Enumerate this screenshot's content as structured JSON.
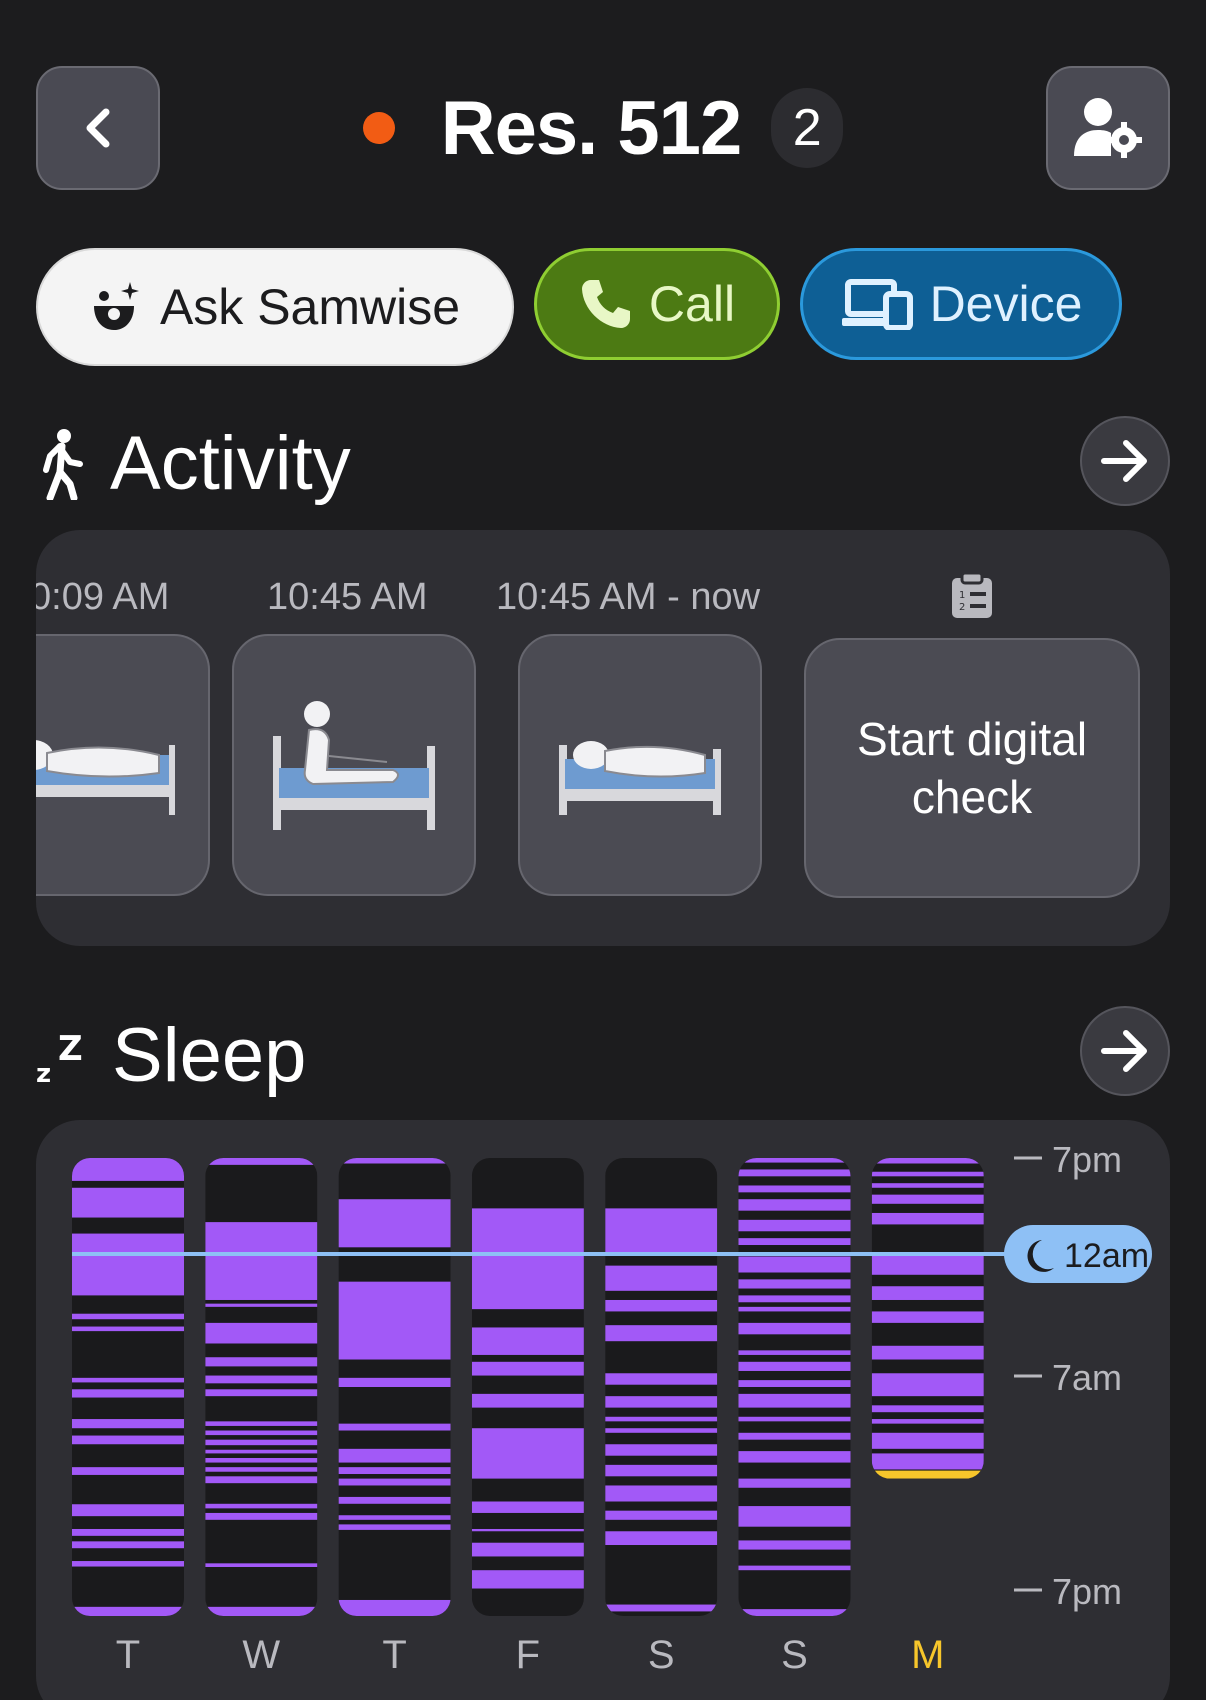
{
  "header": {
    "back_icon": "chevron-left-icon",
    "status_color": "#f25c14",
    "title": "Res. 512",
    "count": "2",
    "profile_icon": "user-settings-icon"
  },
  "actions": {
    "samwise_label": "Ask Samwise",
    "call_label": "Call",
    "device_label": "Device"
  },
  "activity": {
    "title": "Activity",
    "items": [
      {
        "time": "0:09 AM",
        "icon": "bed-lying-icon"
      },
      {
        "time": "10:45 AM",
        "icon": "bed-sitting-icon"
      },
      {
        "time": "10:45 AM - now",
        "icon": "bed-lying-icon"
      }
    ],
    "check_icon": "clipboard-list-icon",
    "check_label": "Start digital check"
  },
  "sleep": {
    "title": "Sleep",
    "now_label": "12am"
  },
  "chart_data": {
    "type": "heatmap",
    "categories": [
      "T",
      "W",
      "T",
      "F",
      "S",
      "S",
      "M"
    ],
    "highlighted_category": "M",
    "y_ticks": [
      "7pm",
      "7am",
      "7pm"
    ],
    "current_marker": "12am",
    "colors": {
      "asleep": "#a259f7",
      "awake": "#1a1a1c",
      "highlight": "#f7c62b",
      "marker": "#8ec0f5"
    },
    "series": [
      {
        "day": "T",
        "asleep": [
          [
            0,
            0.05
          ],
          [
            0.065,
            0.13
          ],
          [
            0.165,
            0.3
          ],
          [
            0.34,
            0.352
          ],
          [
            0.368,
            0.378
          ],
          [
            0.48,
            0.49
          ],
          [
            0.505,
            0.523
          ],
          [
            0.57,
            0.59
          ],
          [
            0.606,
            0.625
          ],
          [
            0.675,
            0.692
          ],
          [
            0.756,
            0.782
          ],
          [
            0.81,
            0.825
          ],
          [
            0.837,
            0.852
          ],
          [
            0.88,
            0.892
          ],
          [
            0.98,
            1.0
          ]
        ]
      },
      {
        "day": "W",
        "asleep": [
          [
            0,
            0.015
          ],
          [
            0.14,
            0.31
          ],
          [
            0.318,
            0.325
          ],
          [
            0.36,
            0.405
          ],
          [
            0.435,
            0.455
          ],
          [
            0.475,
            0.492
          ],
          [
            0.505,
            0.52
          ],
          [
            0.575,
            0.585
          ],
          [
            0.595,
            0.605
          ],
          [
            0.615,
            0.627
          ],
          [
            0.637,
            0.645
          ],
          [
            0.655,
            0.665
          ],
          [
            0.675,
            0.685
          ],
          [
            0.695,
            0.71
          ],
          [
            0.755,
            0.765
          ],
          [
            0.775,
            0.79
          ],
          [
            0.885,
            0.893
          ],
          [
            0.98,
            1.0
          ]
        ]
      },
      {
        "day": "T",
        "asleep": [
          [
            0,
            0.012
          ],
          [
            0.09,
            0.195
          ],
          [
            0.27,
            0.44
          ],
          [
            0.48,
            0.5
          ],
          [
            0.58,
            0.595
          ],
          [
            0.635,
            0.665
          ],
          [
            0.675,
            0.69
          ],
          [
            0.7,
            0.715
          ],
          [
            0.74,
            0.755
          ],
          [
            0.78,
            0.79
          ],
          [
            0.8,
            0.812
          ],
          [
            0.965,
            1.0
          ]
        ]
      },
      {
        "day": "F",
        "asleep": [
          [
            0.11,
            0.33
          ],
          [
            0.37,
            0.43
          ],
          [
            0.445,
            0.475
          ],
          [
            0.515,
            0.545
          ],
          [
            0.59,
            0.7
          ],
          [
            0.75,
            0.775
          ],
          [
            0.81,
            0.815
          ],
          [
            0.84,
            0.87
          ],
          [
            0.9,
            0.94
          ]
        ]
      },
      {
        "day": "S",
        "asleep": [
          [
            0.11,
            0.21
          ],
          [
            0.235,
            0.29
          ],
          [
            0.31,
            0.335
          ],
          [
            0.365,
            0.4
          ],
          [
            0.47,
            0.495
          ],
          [
            0.52,
            0.545
          ],
          [
            0.565,
            0.575
          ],
          [
            0.59,
            0.6
          ],
          [
            0.625,
            0.65
          ],
          [
            0.67,
            0.695
          ],
          [
            0.715,
            0.75
          ],
          [
            0.77,
            0.79
          ],
          [
            0.815,
            0.845
          ],
          [
            0.975,
            0.99
          ]
        ]
      },
      {
        "day": "S",
        "asleep": [
          [
            0,
            0.01
          ],
          [
            0.025,
            0.04
          ],
          [
            0.06,
            0.075
          ],
          [
            0.09,
            0.115
          ],
          [
            0.135,
            0.16
          ],
          [
            0.175,
            0.19
          ],
          [
            0.215,
            0.25
          ],
          [
            0.265,
            0.285
          ],
          [
            0.3,
            0.315
          ],
          [
            0.325,
            0.335
          ],
          [
            0.36,
            0.385
          ],
          [
            0.42,
            0.43
          ],
          [
            0.445,
            0.465
          ],
          [
            0.485,
            0.5
          ],
          [
            0.515,
            0.545
          ],
          [
            0.565,
            0.575
          ],
          [
            0.6,
            0.615
          ],
          [
            0.64,
            0.665
          ],
          [
            0.7,
            0.72
          ],
          [
            0.76,
            0.805
          ],
          [
            0.835,
            0.855
          ],
          [
            0.89,
            0.9
          ],
          [
            0.985,
            1.0
          ]
        ]
      },
      {
        "day": "M",
        "asleep": [
          [
            0,
            0.012
          ],
          [
            0.03,
            0.04
          ],
          [
            0.055,
            0.065
          ],
          [
            0.08,
            0.1
          ],
          [
            0.12,
            0.145
          ],
          [
            0.21,
            0.255
          ],
          [
            0.28,
            0.31
          ],
          [
            0.335,
            0.36
          ],
          [
            0.41,
            0.44
          ],
          [
            0.47,
            0.52
          ],
          [
            0.54,
            0.555
          ],
          [
            0.57,
            0.58
          ],
          [
            0.6,
            0.635
          ],
          [
            0.645,
            0.68
          ]
        ],
        "highlight_end": true
      }
    ]
  }
}
